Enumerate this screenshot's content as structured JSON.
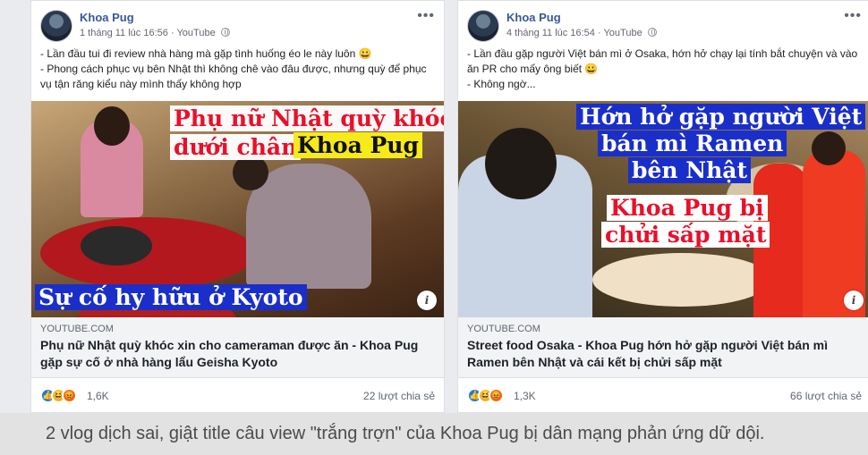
{
  "posts": [
    {
      "author": "Khoa Pug",
      "timestamp": "1 tháng 11 lúc 16:56",
      "source": "YouTube",
      "lines": [
        "- Lần đầu tui đi review nhà hàng mà gặp tình huống éo le này luôn 😀",
        "- Phong cách phục vụ bên Nhật thì không chê vào đâu được, nhưng quỳ để phục vụ tận răng kiểu này mình thấy không hợp"
      ],
      "thumb_captions": [
        "Phụ nữ Nhật quỳ khóc",
        "dưới chân",
        "Khoa Pug",
        "Sự cố hy hữu ở Kyoto"
      ],
      "link_domain": "YOUTUBE.COM",
      "link_title": "Phụ nữ Nhật quỳ khóc xin cho cameraman được ăn - Khoa Pug gặp sự cố ở nhà hàng lẩu Geisha Kyoto",
      "reaction_count": "1,6K",
      "shares": "22 lượt chia sẻ"
    },
    {
      "author": "Khoa Pug",
      "timestamp": "4 tháng 11 lúc 16:54",
      "source": "YouTube",
      "lines": [
        "- Lần đầu gặp người Việt bán mì ở Osaka, hớn hở chạy lại tính bắt chuyện và vào ăn PR cho mấy ông biết 😀",
        "- Không ngờ..."
      ],
      "thumb_captions": [
        "Hớn hở gặp người Việt",
        "bán mì Ramen",
        "bên Nhật",
        "Khoa Pug bị",
        "chửi sấp mặt"
      ],
      "link_domain": "YOUTUBE.COM",
      "link_title": "Street food Osaka - Khoa Pug hớn hở gặp người Việt bán mì Ramen bên Nhật và cái kết bị chửi sấp mặt",
      "reaction_count": "1,3K",
      "shares": "66 lượt chia sẻ"
    }
  ],
  "icons": [
    "more-dots-icon",
    "globe-icon",
    "info-icon",
    "like-reaction-icon",
    "haha-reaction-icon",
    "angry-reaction-icon"
  ],
  "colors": {
    "author": "#385898",
    "caption_red": "#e8102a",
    "caption_yellow": "#f7ea1a",
    "caption_blue": "#1a2fc9"
  },
  "caption": "2 vlog dịch sai, giật title câu view \"trắng trợn\" của Khoa Pug bị dân mạng phản ứng dữ dội."
}
